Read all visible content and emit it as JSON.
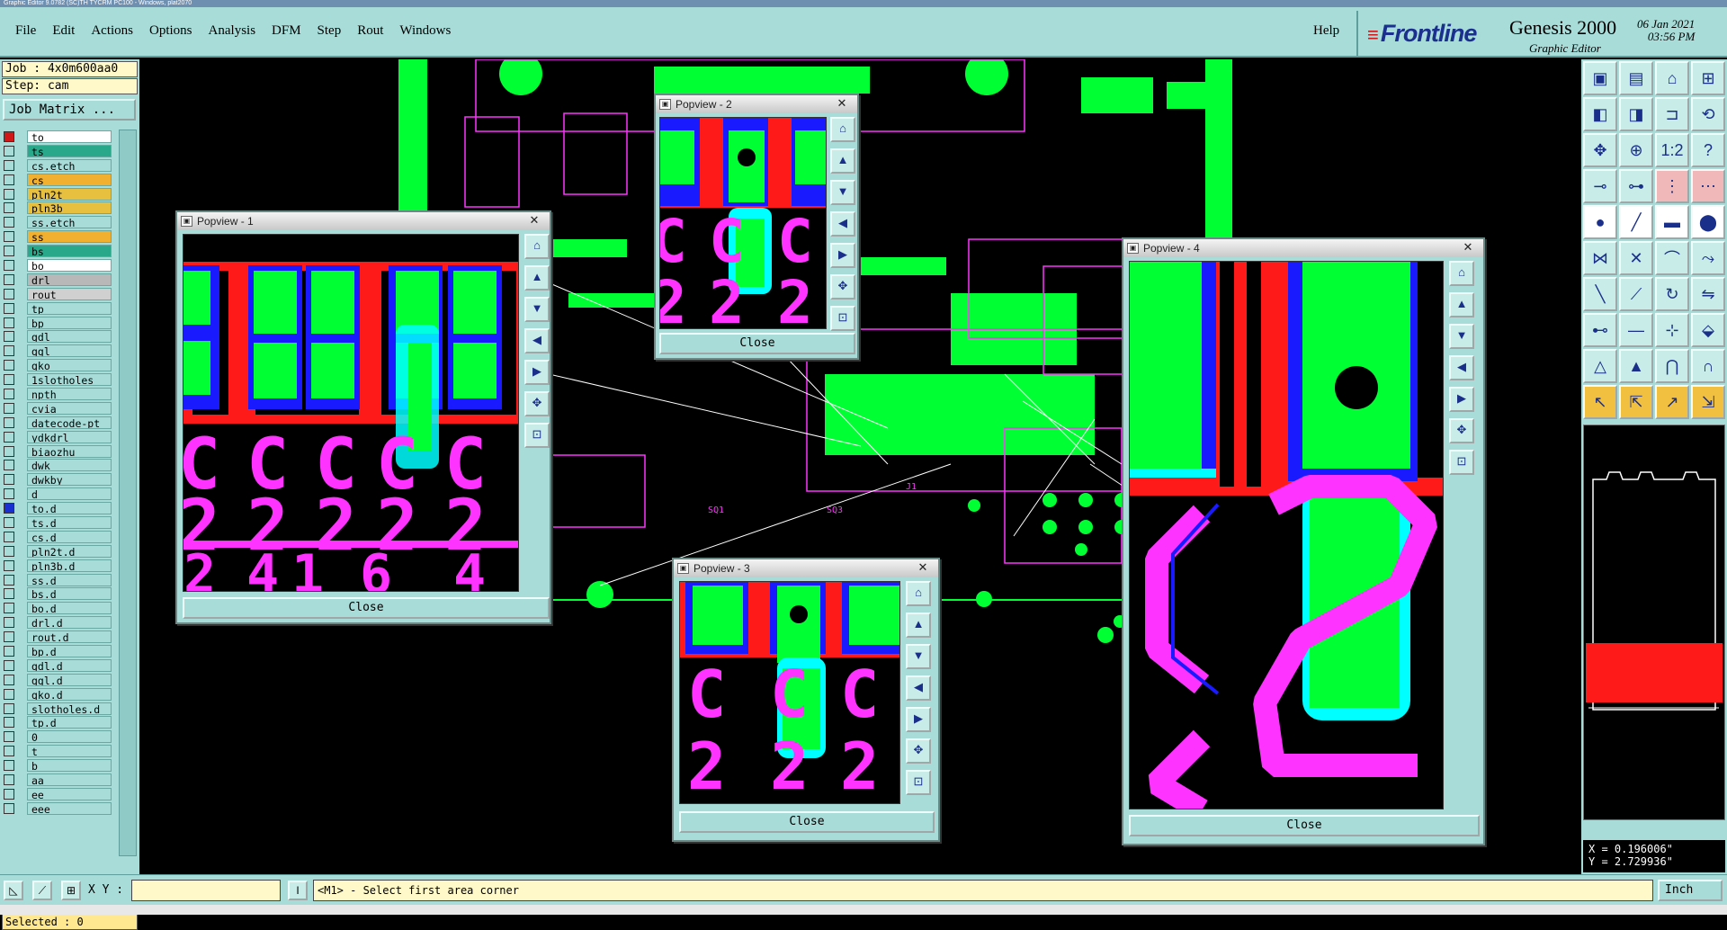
{
  "window": {
    "title": "Graphic Editor 9.0782 (SC)TH TYCRM PC100 - Windows, plat2070"
  },
  "menu": [
    "File",
    "Edit",
    "Actions",
    "Options",
    "Analysis",
    "DFM",
    "Step",
    "Rout",
    "Windows"
  ],
  "help": "Help",
  "brand": {
    "logo": "Frontline",
    "product": "Genesis 2000",
    "subtitle": "Graphic Editor",
    "date": "06 Jan 2021",
    "time": "03:56 PM"
  },
  "job": "Job : 4x0m600aa0",
  "step": "Step: cam",
  "job_matrix": "Job Matrix ...",
  "layers": [
    {
      "name": "to",
      "color": "#ffffff",
      "mark": "#d01818"
    },
    {
      "name": "ts",
      "color": "#2aa88a"
    },
    {
      "name": "cs.etch",
      "color": "#a8dcd8"
    },
    {
      "name": "cs",
      "color": "#f2b030"
    },
    {
      "name": "pln2t",
      "color": "#e8c040"
    },
    {
      "name": "pln3b",
      "color": "#e8c040"
    },
    {
      "name": "ss.etch",
      "color": "#a8dcd8"
    },
    {
      "name": "ss",
      "color": "#f2b030"
    },
    {
      "name": "bs",
      "color": "#2aa88a"
    },
    {
      "name": "bo",
      "color": "#ffffff"
    },
    {
      "name": "drl",
      "color": "#b8b8b8"
    },
    {
      "name": "rout",
      "color": "#d0d0d0"
    },
    {
      "name": "tp",
      "color": "#a8dcd8"
    },
    {
      "name": "bp",
      "color": "#a8dcd8"
    },
    {
      "name": "gdl",
      "color": "#a8dcd8"
    },
    {
      "name": "ggl",
      "color": "#a8dcd8"
    },
    {
      "name": "gko",
      "color": "#a8dcd8"
    },
    {
      "name": "1slotholes",
      "color": "#a8dcd8"
    },
    {
      "name": "npth",
      "color": "#a8dcd8"
    },
    {
      "name": "cvia",
      "color": "#a8dcd8"
    },
    {
      "name": "datecode-pt",
      "color": "#a8dcd8"
    },
    {
      "name": "ydkdrl",
      "color": "#a8dcd8"
    },
    {
      "name": "biaozhu",
      "color": "#a8dcd8"
    },
    {
      "name": "dwk",
      "color": "#a8dcd8"
    },
    {
      "name": "dwkby",
      "color": "#a8dcd8"
    },
    {
      "name": "d",
      "color": "#a8dcd8"
    },
    {
      "name": "to.d",
      "color": "#a8dcd8",
      "mark": "#1a2fd0"
    },
    {
      "name": "ts.d",
      "color": "#a8dcd8"
    },
    {
      "name": "cs.d",
      "color": "#a8dcd8"
    },
    {
      "name": "pln2t.d",
      "color": "#a8dcd8"
    },
    {
      "name": "pln3b.d",
      "color": "#a8dcd8"
    },
    {
      "name": "ss.d",
      "color": "#a8dcd8"
    },
    {
      "name": "bs.d",
      "color": "#a8dcd8"
    },
    {
      "name": "bo.d",
      "color": "#a8dcd8"
    },
    {
      "name": "drl.d",
      "color": "#a8dcd8"
    },
    {
      "name": "rout.d",
      "color": "#a8dcd8"
    },
    {
      "name": "bp.d",
      "color": "#a8dcd8"
    },
    {
      "name": "gdl.d",
      "color": "#a8dcd8"
    },
    {
      "name": "ggl.d",
      "color": "#a8dcd8"
    },
    {
      "name": "gko.d",
      "color": "#a8dcd8"
    },
    {
      "name": "slotholes.d",
      "color": "#a8dcd8"
    },
    {
      "name": "tp.d",
      "color": "#a8dcd8"
    },
    {
      "name": "0",
      "color": "#a8dcd8"
    },
    {
      "name": "t",
      "color": "#a8dcd8"
    },
    {
      "name": "b",
      "color": "#a8dcd8"
    },
    {
      "name": "aa",
      "color": "#a8dcd8"
    },
    {
      "name": "ee",
      "color": "#a8dcd8"
    },
    {
      "name": "eee",
      "color": "#a8dcd8"
    }
  ],
  "selected": "Selected : 0",
  "popviews": [
    {
      "title": "Popview - 1",
      "close": "Close"
    },
    {
      "title": "Popview - 2",
      "close": "Close"
    },
    {
      "title": "Popview - 3",
      "close": "Close"
    },
    {
      "title": "Popview - 4",
      "close": "Close"
    }
  ],
  "coords": {
    "x": "X = 0.196006\"",
    "y": "Y = 2.729936\""
  },
  "status": {
    "xy_label": "X Y :",
    "xy_value": "",
    "prompt": "<M1> - Select first area corner",
    "units": "Inch"
  },
  "colors": {
    "panel": "#a8dcd8",
    "pad": "#00ff33",
    "trace": "#ff1a1a",
    "silk": "#ff33ff",
    "solder": "#1a1aff",
    "cyan": "#00ffff"
  }
}
